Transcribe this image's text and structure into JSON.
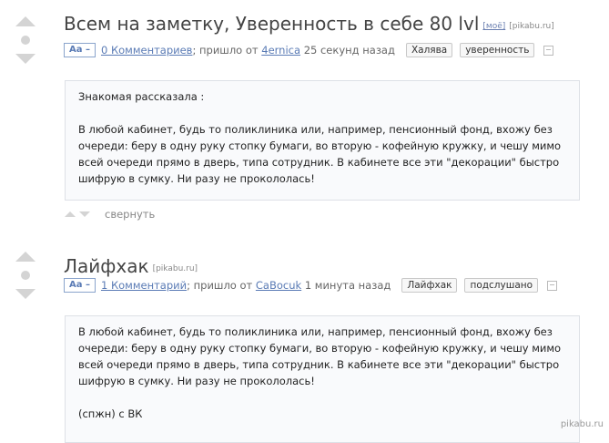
{
  "posts": [
    {
      "title": "Всем на заметку, Уверенность в себе 80 lvl",
      "title_tags": [
        "[моё]",
        "[pikabu.ru]"
      ],
      "aa_label": "Aa –",
      "comments": "0 Комментариев",
      "meta_sep": ";",
      "from_text": "пришло от",
      "author": "4ernica",
      "time": "25 секунд назад",
      "tags": [
        "Халява",
        "уверенность"
      ],
      "body": [
        "Знакомая рассказала :",
        "",
        "В любой кабинет, будь то поликлиника или, например, пенсионный фонд, вхожу без очереди: беру в одну руку стопку бумаги, во вторую - кофейную кружку, и чешу мимо всей очереди прямо в дверь, типа сотрудник. В кабинете все эти \"декорации\" быстро шифрую в сумку. Ни разу не прокололась!"
      ],
      "collapse_label": "свернуть"
    },
    {
      "title": "Лайфхак",
      "title_tags": [
        "[pikabu.ru]"
      ],
      "aa_label": "Aa –",
      "comments": "1 Комментарий",
      "meta_sep": ";",
      "from_text": "пришло от",
      "author": "CaBocuk",
      "time": "1 минута назад",
      "tags": [
        "Лайфхак",
        "подслушано"
      ],
      "body": [
        "В любой кабинет, будь то поликлиника или, например, пенсионный фонд, вхожу без очереди: беру в одну руку стопку бумаги, во вторую - кофейную кружку, и чешу мимо всей очереди прямо в дверь, типа сотрудник. В кабинете все эти \"декорации\" быстро шифрую в сумку. Ни разу не прокололась!",
        "",
        "(спжн) с ВК"
      ]
    }
  ],
  "watermark": "pikabu.ru"
}
